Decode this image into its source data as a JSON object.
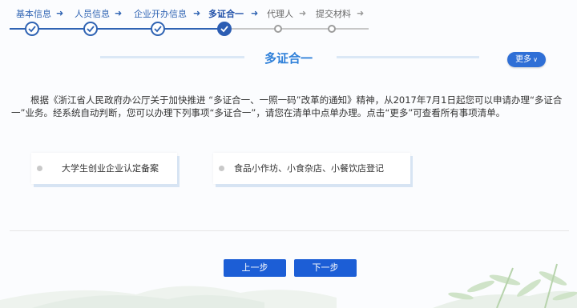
{
  "steps": [
    {
      "label": "基本信息",
      "status": "done"
    },
    {
      "label": "人员信息",
      "status": "done"
    },
    {
      "label": "企业开办信息",
      "status": "done"
    },
    {
      "label": "多证合一",
      "status": "current"
    },
    {
      "label": "代理人",
      "status": "pending"
    },
    {
      "label": "提交材料",
      "status": "pending"
    }
  ],
  "header": {
    "title": "多证合一",
    "more_label": "更多"
  },
  "intro_text": "根据《浙江省人民政府办公厅关于加快推进 “多证合一、一照一码”改革的通知》精神，从2017年7月1日起您可以申请办理“多证合一”业务。经系统自动判断，您可以办理下列事项“多证合一”，请您在清单中点单办理。点击“更多”可查看所有事项清单。",
  "items": [
    {
      "label": "大学生创业企业认定备案"
    },
    {
      "label": "食品小作坊、小食杂店、小餐饮店登记"
    }
  ],
  "buttons": {
    "prev_label": "上一步",
    "next_label": "下一步"
  },
  "colors": {
    "accent": "#2f63b3",
    "title": "#2f80d9",
    "button": "#1c5ed6"
  }
}
